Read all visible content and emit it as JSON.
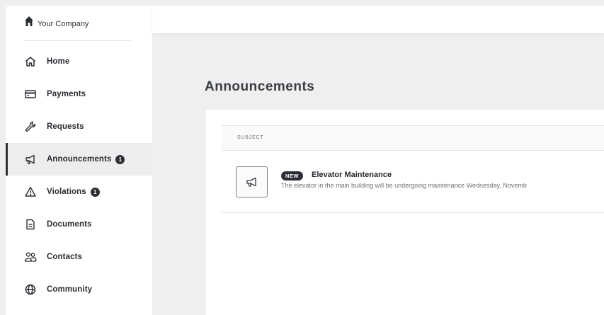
{
  "brand": {
    "name": "Your Company",
    "icon": "house-icon"
  },
  "sidebar": {
    "items": [
      {
        "label": "Home",
        "icon": "home-icon"
      },
      {
        "label": "Payments",
        "icon": "credit-card-icon"
      },
      {
        "label": "Requests",
        "icon": "wrench-icon"
      },
      {
        "label": "Announcements",
        "icon": "megaphone-icon",
        "badge": "1",
        "active": true
      },
      {
        "label": "Violations",
        "icon": "warning-icon",
        "badge": "1"
      },
      {
        "label": "Documents",
        "icon": "document-icon"
      },
      {
        "label": "Contacts",
        "icon": "contacts-icon"
      },
      {
        "label": "Community",
        "icon": "globe-icon"
      }
    ]
  },
  "main": {
    "title": "Announcements",
    "table": {
      "columns": [
        "SUBJECT"
      ],
      "rows": [
        {
          "badge": "NEW",
          "title": "Elevator Maintenance",
          "description": "The elevator in the main building will be undergoing maintenance Wednesday, Novemb",
          "icon": "megaphone-icon"
        }
      ]
    }
  },
  "colors": {
    "accent": "#2c3036",
    "active_bg": "#ededee",
    "page_bg": "#efefef"
  }
}
